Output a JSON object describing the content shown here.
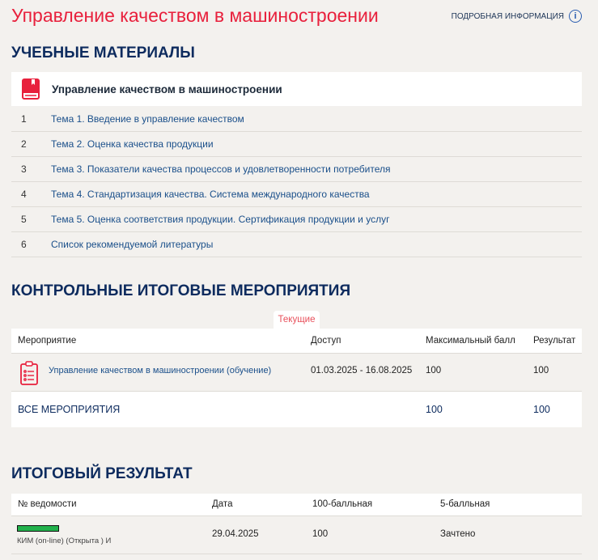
{
  "title": "Управление качеством в машиностроении",
  "info_link": "ПОДРОБНАЯ ИНФОРМАЦИЯ",
  "materials": {
    "heading": "УЧЕБНЫЕ МАТЕРИАЛЫ",
    "course": "Управление качеством в машиностроении",
    "items": [
      {
        "n": "1",
        "label": "Тема 1. Введение в управление качеством"
      },
      {
        "n": "2",
        "label": "Тема 2. Оценка качества продукции"
      },
      {
        "n": "3",
        "label": "Тема 3. Показатели качества процессов и удовлетворенности потребителя"
      },
      {
        "n": "4",
        "label": "Тема 4. Стандартизация качества. Система международного качества"
      },
      {
        "n": "5",
        "label": "Тема 5. Оценка соответствия продукции. Сертификация продукции и услуг"
      },
      {
        "n": "6",
        "label": "Список рекомендуемой литературы"
      }
    ]
  },
  "events": {
    "heading": "КОНТРОЛЬНЫЕ ИТОГОВЫЕ МЕРОПРИЯТИЯ",
    "tab": "Текущие",
    "columns": [
      "Мероприятие",
      "Доступ",
      "Максимальный балл",
      "Результат"
    ],
    "row": {
      "name": "Управление качеством в машиностроении (обучение)",
      "access": "01.03.2025 - 16.08.2025",
      "max": "100",
      "result": "100"
    },
    "total": {
      "label": "ВСЕ МЕРОПРИЯТИЯ",
      "max": "100",
      "result": "100"
    }
  },
  "final": {
    "heading": "ИТОГОВЫЙ РЕЗУЛЬТАТ",
    "columns": [
      "№ ведомости",
      "Дата",
      "100-балльная",
      "5-балльная"
    ],
    "row": {
      "sheet": "КИМ (on-line) (Открыта ) И",
      "date": "29.04.2025",
      "score100": "100",
      "score5": "Зачтено",
      "status_color": "#22b14c"
    }
  }
}
